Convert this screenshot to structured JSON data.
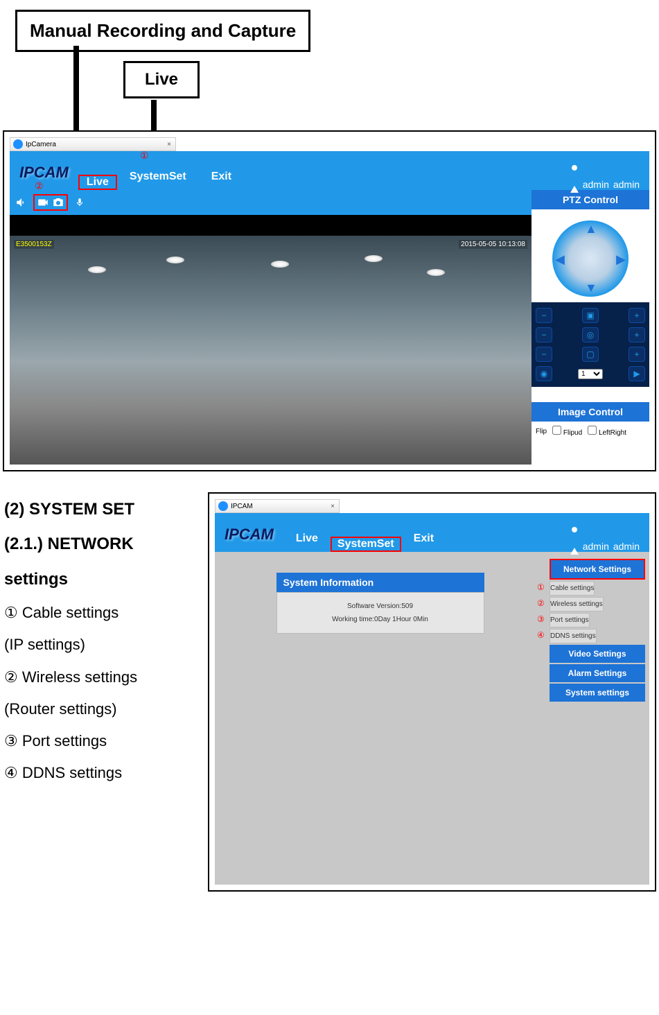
{
  "callouts": {
    "manual_rec": "Manual Recording and Capture",
    "live": "Live"
  },
  "screenshot1": {
    "tab_title": "IpCamera",
    "logo": "IPCAM",
    "nav": {
      "live": "Live",
      "systemset": "SystemSet",
      "exit": "Exit"
    },
    "user_role": "admin",
    "user_name": "admin",
    "circled_1": "①",
    "circled_2": "②",
    "video": {
      "id": "E3500153Z",
      "timestamp": "2015-05-05 10:13:08"
    },
    "ptz_title": "PTZ Control",
    "preset_value": "1",
    "image_control_title": "Image Control",
    "flip_label": "Flip",
    "flipud_label": "Flipud",
    "leftright_label": "LeftRight"
  },
  "screenshot2": {
    "tab_title": "IPCAM",
    "logo": "IPCAM",
    "nav": {
      "live": "Live",
      "systemset": "SystemSet",
      "exit": "Exit"
    },
    "user_role": "admin",
    "user_name": "admin",
    "panel_title": "System Information",
    "software_line": "Software Version:509",
    "working_line": "Working time:0Day 1Hour 0Min",
    "cats": {
      "network": "Network Settings",
      "video": "Video Settings",
      "alarm": "Alarm Settings",
      "system": "System settings"
    },
    "items": {
      "cable": "Cable settings",
      "wireless": "Wireless settings",
      "port": "Port settings",
      "ddns": "DDNS settings"
    },
    "nums": {
      "n1": "①",
      "n2": "②",
      "n3": "③",
      "n4": "④"
    }
  },
  "doc": {
    "h2": "(2) SYSTEM SET",
    "h21": "(2.1.) NETWORK settings",
    "l1a": "① Cable settings",
    "l1b": "(IP settings)",
    "l2a": "② Wireless settings",
    "l2b": "(Router settings)",
    "l3": "③ Port settings",
    "l4": "④ DDNS settings"
  }
}
